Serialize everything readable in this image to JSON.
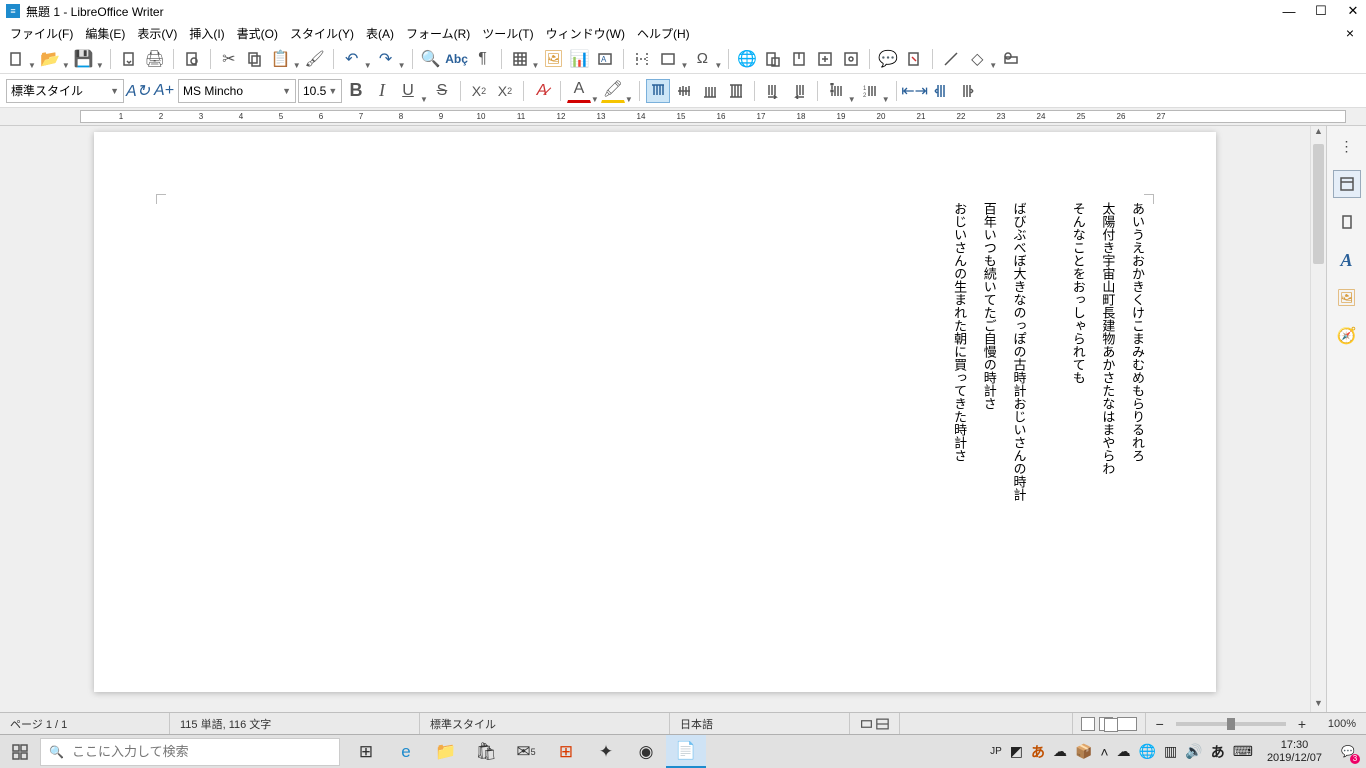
{
  "window": {
    "title": "無題 1 - LibreOffice Writer"
  },
  "menus": [
    "ファイル(F)",
    "編集(E)",
    "表示(V)",
    "挿入(I)",
    "書式(O)",
    "スタイル(Y)",
    "表(A)",
    "フォーム(R)",
    "ツール(T)",
    "ウィンドウ(W)",
    "ヘルプ(H)"
  ],
  "format": {
    "para_style": "標準スタイル",
    "font_name": "MS Mincho",
    "font_size": "10.5"
  },
  "ruler": {
    "numbers": [
      1,
      2,
      3,
      4,
      5,
      6,
      7,
      8,
      9,
      10,
      11,
      12,
      13,
      14,
      15,
      16,
      17,
      18,
      19,
      20,
      21,
      22,
      23,
      24,
      25,
      26,
      27
    ]
  },
  "document": {
    "lines": [
      "あいうえおかきくけこまみむめもらりるれろ",
      "太陽付き宇宙山町長建物あかさたなはまやらわ",
      "そんなことをおっしゃられても",
      "",
      "ばびぶべぼ大きなのっぽの古時計おじいさんの時計",
      "百年いつも続いてたご自慢の時計さ",
      "おじいさんの生まれた朝に買ってきた時計さ"
    ]
  },
  "status": {
    "page": "ページ 1 / 1",
    "words": "115 単語, 116 文字",
    "page_style": "標準スタイル",
    "language": "日本語",
    "zoom": "100%"
  },
  "taskbar": {
    "search_placeholder": "ここに入力して検索",
    "ime_mode": "あ",
    "ime_lang": "JP",
    "time": "17:30",
    "date": "2019/12/07",
    "notif_count": "3"
  }
}
